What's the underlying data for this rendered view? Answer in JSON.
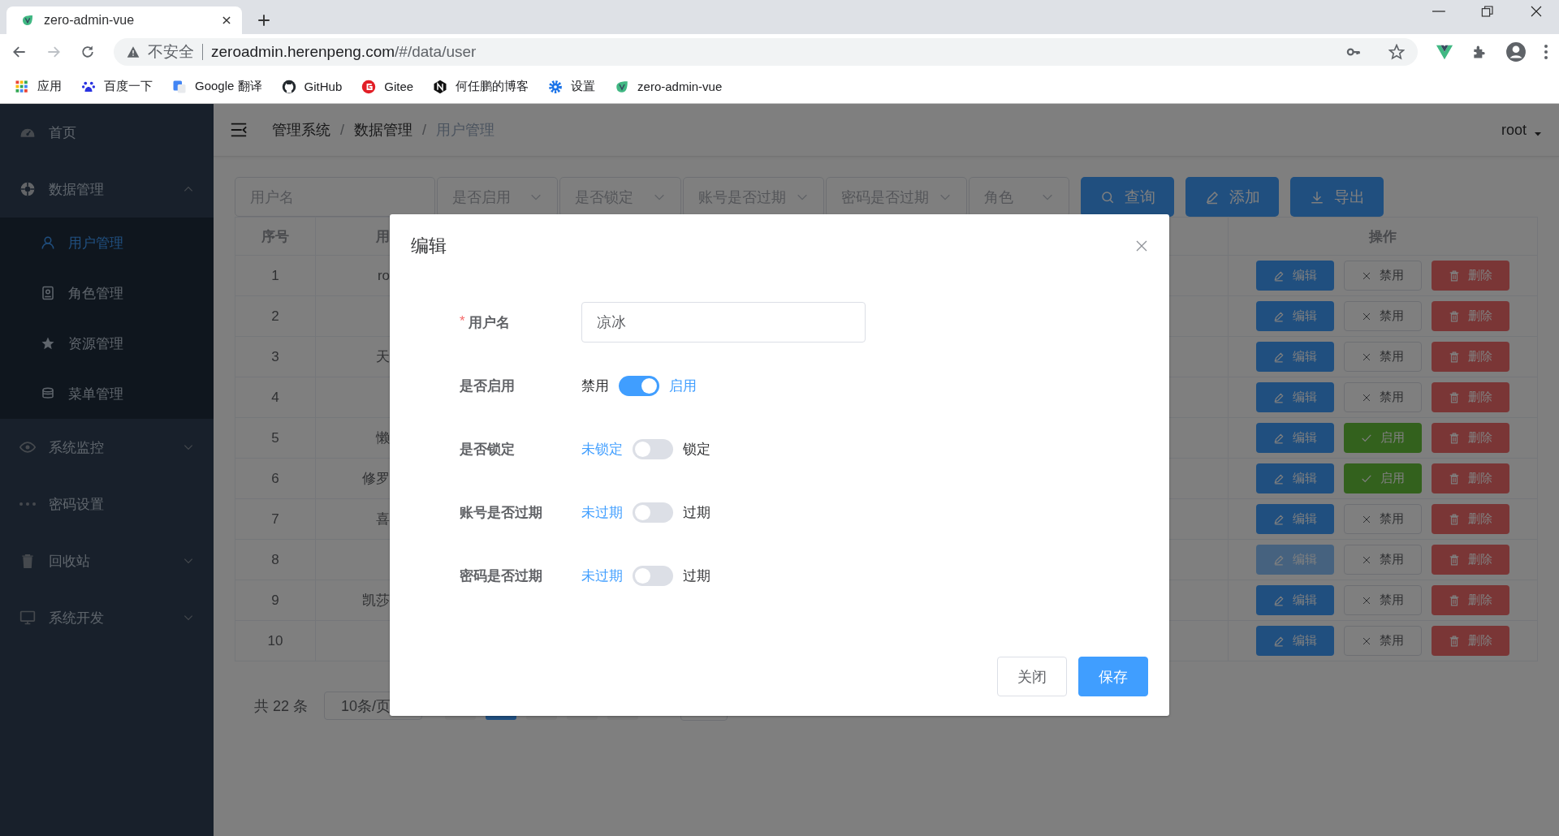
{
  "browser": {
    "tab_title": "zero-admin-vue",
    "security_label": "不安全",
    "url_host": "zeroadmin.herenpeng.com",
    "url_path": "/#/data/user",
    "bookmarks": [
      {
        "label": "应用"
      },
      {
        "label": "百度一下"
      },
      {
        "label": "Google 翻译"
      },
      {
        "label": "GitHub"
      },
      {
        "label": "Gitee"
      },
      {
        "label": "何任鹏的博客"
      },
      {
        "label": "设置"
      },
      {
        "label": "zero-admin-vue"
      }
    ]
  },
  "sidebar": {
    "items": [
      {
        "label": "首页",
        "selected": false
      },
      {
        "label": "数据管理",
        "selected": false,
        "expanded": true,
        "children": [
          {
            "label": "用户管理",
            "selected": true
          },
          {
            "label": "角色管理",
            "selected": false
          },
          {
            "label": "资源管理",
            "selected": false
          },
          {
            "label": "菜单管理",
            "selected": false
          }
        ]
      },
      {
        "label": "系统监控",
        "selected": false,
        "expanded": false
      },
      {
        "label": "密码设置",
        "selected": false
      },
      {
        "label": "回收站",
        "selected": false,
        "expanded": false
      },
      {
        "label": "系统开发",
        "selected": false,
        "expanded": false
      }
    ]
  },
  "header": {
    "breadcrumb": [
      "管理系统",
      "数据管理",
      "用户管理"
    ],
    "separator": "/",
    "user": "root"
  },
  "filters": {
    "username_placeholder": "用户名",
    "selects": [
      {
        "placeholder": "是否启用"
      },
      {
        "placeholder": "是否锁定"
      },
      {
        "placeholder": "账号是否过期"
      },
      {
        "placeholder": "密码是否过期"
      },
      {
        "placeholder": "角色"
      }
    ],
    "buttons": [
      {
        "kind": "search",
        "label": "查询"
      },
      {
        "kind": "add",
        "label": "添加"
      },
      {
        "kind": "export",
        "label": "导出"
      }
    ]
  },
  "table": {
    "columns": [
      "序号",
      "用",
      "操作"
    ],
    "rows": [
      {
        "index": "1",
        "name": "ro",
        "edit": {
          "label": "编辑",
          "hovered": false
        },
        "toggle": {
          "kind": "disable",
          "label": "禁用"
        },
        "delete": "删除"
      },
      {
        "index": "2",
        "edit": {
          "label": "编辑",
          "hovered": false
        },
        "toggle": {
          "kind": "disable",
          "label": "禁用"
        },
        "delete": "删除"
      },
      {
        "index": "3",
        "name": "天",
        "edit": {
          "label": "编辑",
          "hovered": false
        },
        "toggle": {
          "kind": "disable",
          "label": "禁用"
        },
        "delete": "删除"
      },
      {
        "index": "4",
        "edit": {
          "label": "编辑",
          "hovered": false
        },
        "toggle": {
          "kind": "disable",
          "label": "禁用"
        },
        "delete": "删除"
      },
      {
        "index": "5",
        "name": "懒",
        "edit": {
          "label": "编辑",
          "hovered": false
        },
        "toggle": {
          "kind": "enable",
          "label": "启用"
        },
        "delete": "删除"
      },
      {
        "index": "6",
        "name": "修罗",
        "edit": {
          "label": "编辑",
          "hovered": false
        },
        "toggle": {
          "kind": "enable",
          "label": "启用"
        },
        "delete": "删除"
      },
      {
        "index": "7",
        "name": "喜",
        "edit": {
          "label": "编辑",
          "hovered": false
        },
        "toggle": {
          "kind": "disable",
          "label": "禁用"
        },
        "delete": "删除"
      },
      {
        "index": "8",
        "edit": {
          "label": "编辑",
          "hovered": true
        },
        "toggle": {
          "kind": "disable",
          "label": "禁用"
        },
        "delete": "删除"
      },
      {
        "index": "9",
        "name": "凯莎",
        "edit": {
          "label": "编辑",
          "hovered": false
        },
        "toggle": {
          "kind": "disable",
          "label": "禁用"
        },
        "delete": "删除"
      },
      {
        "index": "10",
        "edit": {
          "label": "编辑",
          "hovered": false
        },
        "toggle": {
          "kind": "disable",
          "label": "禁用"
        },
        "delete": "删除"
      }
    ]
  },
  "pagination": {
    "total": "共 22 条",
    "page_size": "10条/页",
    "pages": [
      {
        "selected": false
      },
      {
        "selected": true
      },
      {
        "selected": false
      },
      {
        "selected": false
      },
      {
        "selected": false
      }
    ]
  },
  "dialog": {
    "title": "编辑",
    "fields": [
      {
        "kind": "text",
        "required_mark": "*",
        "label": "用户名",
        "value": "凉冰"
      },
      {
        "kind": "switch",
        "label": "是否启用",
        "off_text": "禁用",
        "on_text": "启用",
        "on": true
      },
      {
        "kind": "switch",
        "label": "是否锁定",
        "off_text": "未锁定",
        "on_text": "锁定",
        "on": false
      },
      {
        "kind": "switch",
        "label": "账号是否过期",
        "off_text": "未过期",
        "on_text": "过期",
        "on": false
      },
      {
        "kind": "switch",
        "label": "密码是否过期",
        "off_text": "未过期",
        "on_text": "过期",
        "on": false
      }
    ],
    "buttons": [
      {
        "kind": "plain",
        "label": "关闭"
      },
      {
        "kind": "primary",
        "label": "保存"
      }
    ]
  }
}
